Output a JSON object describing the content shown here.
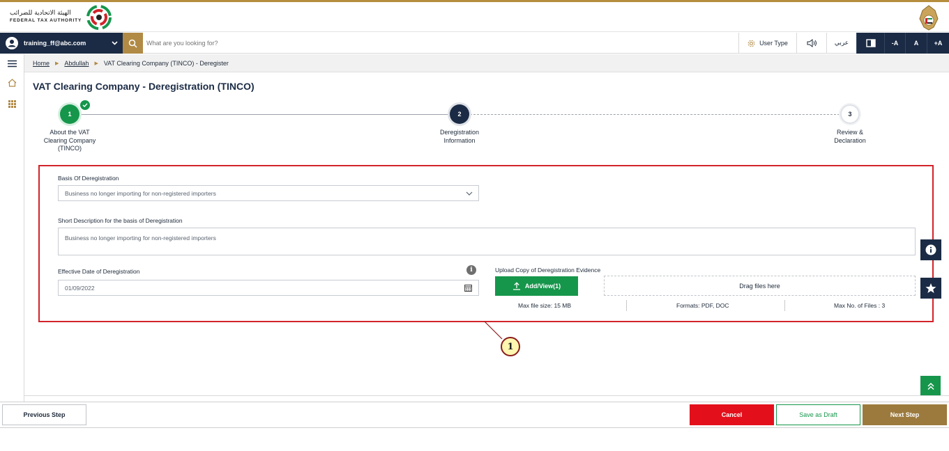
{
  "header": {
    "logo_arabic": "الهيئة الاتحادية للضرائب",
    "logo_english": "FEDERAL TAX AUTHORITY"
  },
  "toolbar": {
    "user_email": "training_ff@abc.com",
    "search_placeholder": "What are you looking for?",
    "user_type_label": "User Type",
    "arabic_label": "عربي",
    "font_decrease": "-A",
    "font_normal": "A",
    "font_increase": "+A"
  },
  "breadcrumb": {
    "home": "Home",
    "account": "Abdullah",
    "current": "VAT Clearing Company (TINCO) - Deregister"
  },
  "page": {
    "title": "VAT Clearing Company - Deregistration (TINCO)"
  },
  "stepper": {
    "steps": [
      {
        "number": "1",
        "label_line1": "About the VAT",
        "label_line2": "Clearing Company",
        "label_line3": "(TINCO)",
        "state": "complete"
      },
      {
        "number": "2",
        "label_line1": "Deregistration",
        "label_line2": "Information",
        "state": "active"
      },
      {
        "number": "3",
        "label_line1": "Review &",
        "label_line2": "Declaration",
        "state": "pending"
      }
    ]
  },
  "form": {
    "basis_label": "Basis Of Deregistration",
    "basis_value": "Business no longer importing for non-registered importers",
    "description_label": "Short Description for the basis of Deregistration",
    "description_value": "Business no longer importing for non-registered importers",
    "date_label": "Effective Date of Deregistration",
    "date_value": "01/09/2022",
    "upload_label": "Upload Copy of Deregistration Evidence",
    "add_view_label": "Add/View(1)",
    "drop_label": "Drag files here",
    "max_size": "Max file size: 15 MB",
    "formats": "Formats: PDF, DOC",
    "max_files": "Max No. of Files : 3"
  },
  "annotation": {
    "callout_number": "1"
  },
  "footer": {
    "previous_label": "Previous Step",
    "cancel_label": "Cancel",
    "draft_label": "Save as Draft",
    "next_label": "Next Step"
  },
  "colors": {
    "navy": "#1b2b45",
    "gold": "#b18a45",
    "green": "#16964b",
    "red": "#e3101b",
    "highlight_red": "#d2232a"
  }
}
